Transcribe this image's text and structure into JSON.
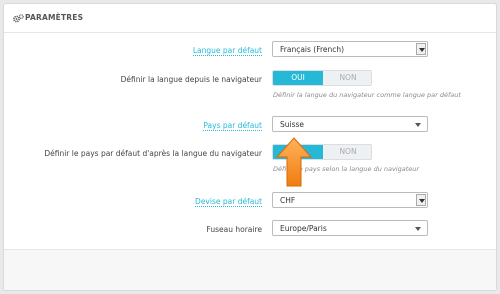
{
  "panel": {
    "title": "PARAMÈTRES",
    "icon": "gears-icon"
  },
  "rows": {
    "default_language": {
      "label": "Langue par défaut",
      "value": "Français (French)"
    },
    "language_from_browser": {
      "label": "Définir la langue depuis le navigateur",
      "yes": "OUI",
      "no": "NON",
      "selected": "OUI",
      "help": "Définir la langue du navigateur comme langue par défaut"
    },
    "default_country": {
      "label": "Pays par défaut",
      "value": "Suisse"
    },
    "country_from_browser": {
      "label": "Définir le pays par défaut d'après la langue du navigateur",
      "yes": "OUI",
      "no": "NON",
      "selected": "OUI",
      "help": "Définir le pays selon la langue du navigateur"
    },
    "default_currency": {
      "label": "Devise par défaut",
      "value": "CHF"
    },
    "timezone": {
      "label": "Fuseau horaire",
      "value": "Europe/Paris"
    }
  },
  "colors": {
    "accent": "#25b9d7",
    "arrow": "#f58220"
  }
}
